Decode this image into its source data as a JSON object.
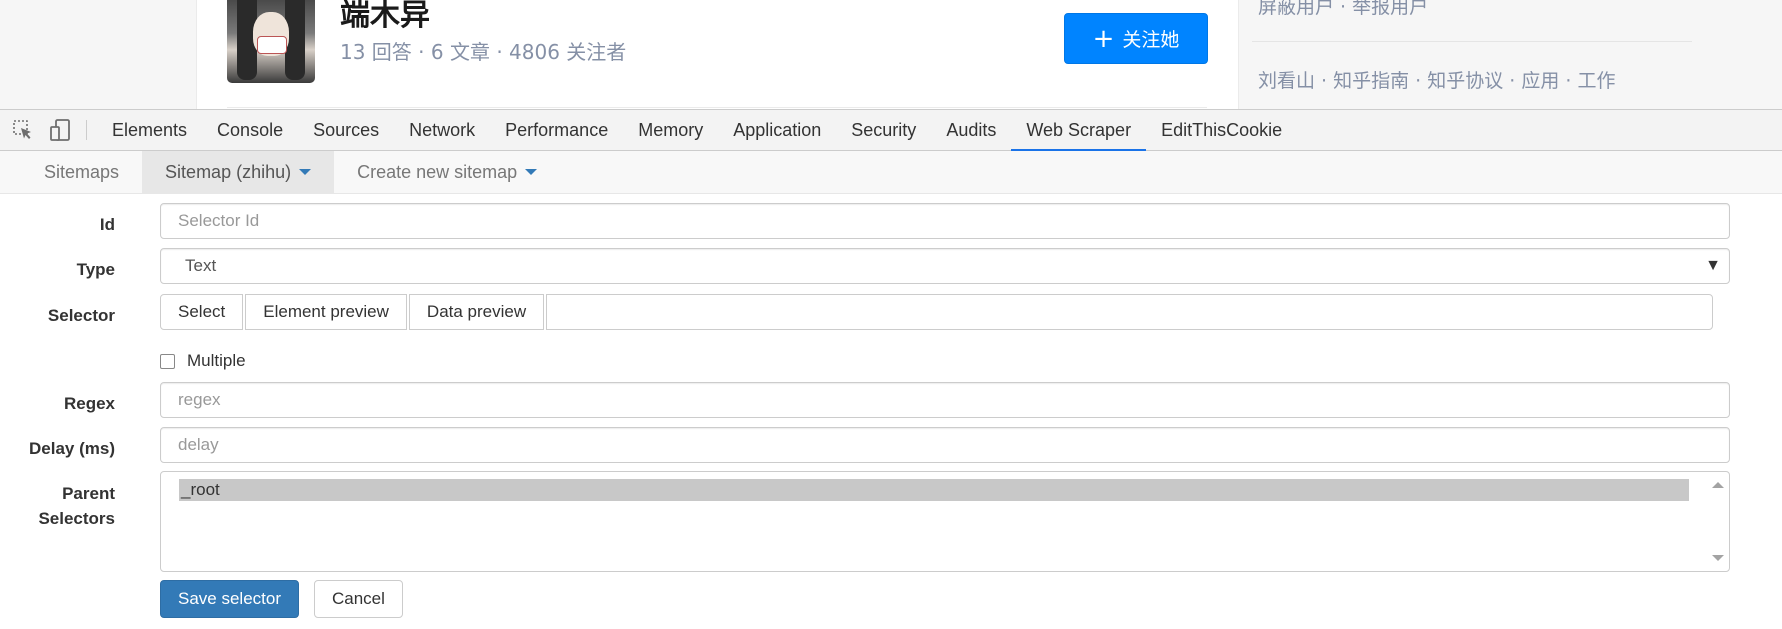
{
  "profile": {
    "name": "端木异",
    "stats": "13 回答 · 6 文章 · 4806 关注者",
    "follow_label": "关注她"
  },
  "sidebar": {
    "links_row1": "屏蔽用户 · 举报用户",
    "links_row2": "刘看山 · 知乎指南 · 知乎协议 · 应用 · 工作"
  },
  "devtools": {
    "tabs": [
      "Elements",
      "Console",
      "Sources",
      "Network",
      "Performance",
      "Memory",
      "Application",
      "Security",
      "Audits",
      "Web Scraper",
      "EditThisCookie"
    ],
    "active_tab": "Web Scraper"
  },
  "scraper": {
    "nav": {
      "sitemaps": "Sitemaps",
      "sitemap_current": "Sitemap (zhihu)",
      "create_new": "Create new sitemap"
    },
    "form": {
      "id_label": "Id",
      "id_placeholder": "Selector Id",
      "type_label": "Type",
      "type_value": "Text",
      "selector_label": "Selector",
      "select_button": "Select",
      "element_preview_button": "Element preview",
      "data_preview_button": "Data preview",
      "multiple_label": "Multiple",
      "regex_label": "Regex",
      "regex_placeholder": "regex",
      "delay_label": "Delay (ms)",
      "delay_placeholder": "delay",
      "parent_label_1": "Parent",
      "parent_label_2": "Selectors",
      "parent_option": "_root",
      "save_button": "Save selector",
      "cancel_button": "Cancel"
    }
  },
  "colors": {
    "zhihu_blue": "#0084ff",
    "primary_button": "#337ab7",
    "active_tab_underline": "#1a73e8",
    "muted_text": "#8590a6"
  }
}
